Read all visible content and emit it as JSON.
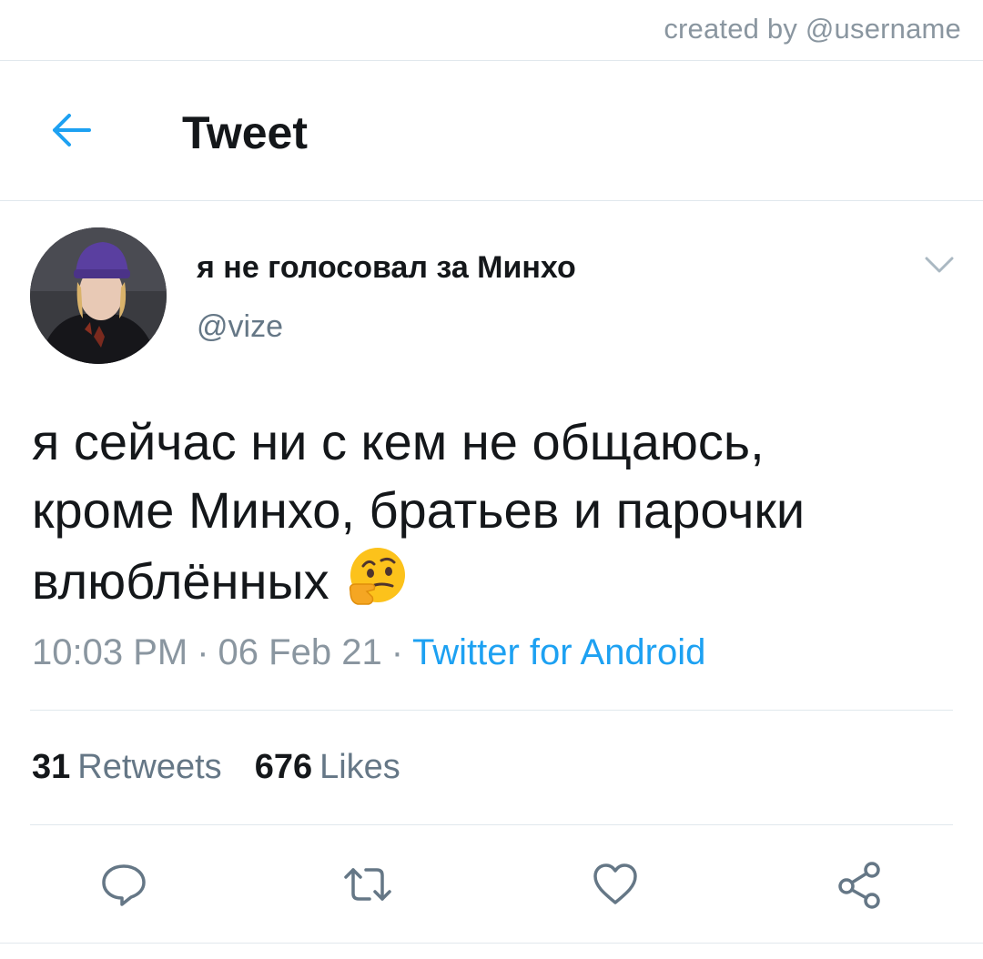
{
  "credit": {
    "text": "created by @username"
  },
  "header": {
    "title": "Tweet",
    "back_icon": "arrow-left-icon",
    "accent": "#1da1f2"
  },
  "tweet": {
    "author": {
      "display_name": "я не голосовал за Минхо",
      "handle": "@vize",
      "avatar_icon": "avatar"
    },
    "text_lines": [
      "я сейчас ни с кем не общаюсь,",
      "кроме Минхо, братьев и парочки",
      "влюблённых"
    ],
    "emoji": "thinking-face-icon",
    "time": "10:03 PM",
    "date": "06 Feb 21",
    "separator": "·",
    "source": "Twitter for Android",
    "stats": {
      "retweets_count": "31",
      "retweets_label": "Retweets",
      "likes_count": "676",
      "likes_label": "Likes"
    }
  },
  "actions": [
    "reply-icon",
    "retweet-icon",
    "like-icon",
    "share-icon"
  ],
  "colors": {
    "text": "#14171a",
    "secondary": "#657786",
    "link": "#1da1f2",
    "divider": "#e1e8ed"
  }
}
